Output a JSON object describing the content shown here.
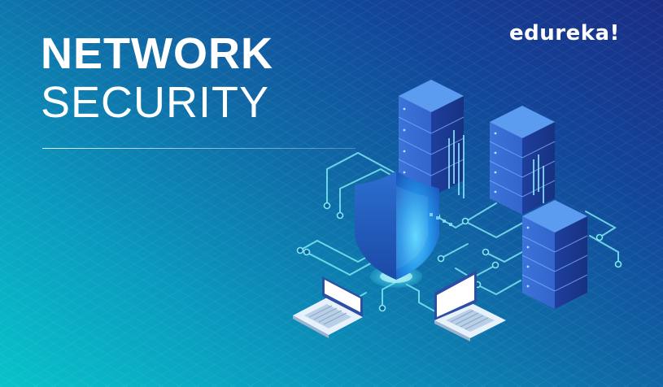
{
  "banner": {
    "title_line1": "NETWORK",
    "title_line2": "SECURITY",
    "brand": "edureka!"
  },
  "colors": {
    "cyan": "#07b6c6",
    "navy": "#1a2d85",
    "circuit": "#7de8f0",
    "server_top": "#4f8de6",
    "server_side": "#2c5fc8",
    "shield": "#2a7fd8"
  },
  "icons": [
    "server-icon",
    "shield-icon",
    "laptop-icon",
    "circuit-lines"
  ]
}
